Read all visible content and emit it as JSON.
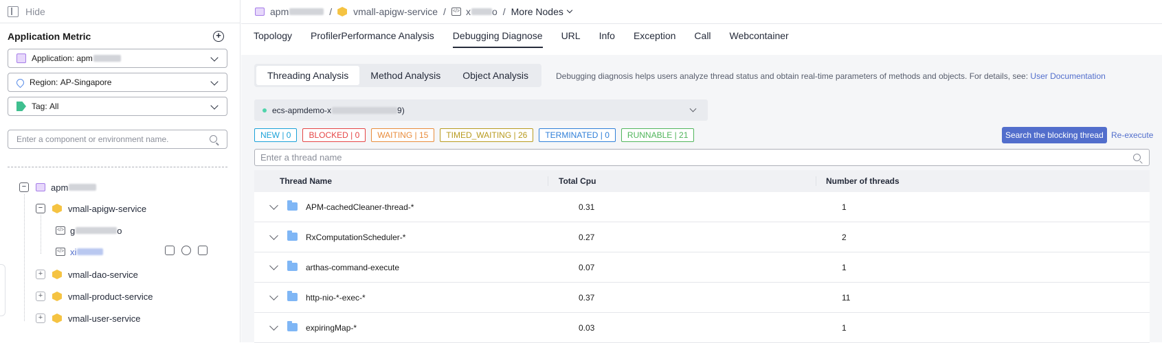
{
  "sidebar": {
    "hide_label": "Hide",
    "title": "Application Metric",
    "application_label": "Application:",
    "application_value": "apm",
    "region_label": "Region:",
    "region_value": "AP-Singapore",
    "tag_label": "Tag:",
    "tag_value": "All",
    "search_placeholder": "Enter a component or environment name.",
    "tree": {
      "root": "apm",
      "service_open": "vmall-apigw-service",
      "env1": "g",
      "env1_tail": "o",
      "env2": "xi",
      "services": [
        "vmall-dao-service",
        "vmall-product-service",
        "vmall-user-service"
      ]
    }
  },
  "breadcrumb": {
    "app": "apm",
    "service": "vmall-apigw-service",
    "env": "x",
    "env_tail": "o",
    "more": "More Nodes",
    "separator": "/"
  },
  "tabs": [
    "Topology",
    "ProfilerPerformance Analysis",
    "Debugging Diagnose",
    "URL",
    "Info",
    "Exception",
    "Call",
    "Webcontainer"
  ],
  "subtabs": [
    "Threading Analysis",
    "Method Analysis",
    "Object Analysis"
  ],
  "description": "Debugging diagnosis helps users analyze thread status and obtain real-time parameters of methods and objects. For details, see:",
  "doc_link": "User Documentation",
  "instance": {
    "prefix": "ecs-apmdemo-x",
    "suffix": "9)"
  },
  "badges": [
    {
      "label": "NEW | 0",
      "color": "#1aa1d8"
    },
    {
      "label": "BLOCKED | 0",
      "color": "#e54545"
    },
    {
      "label": "WAITING | 15",
      "color": "#e88b3a"
    },
    {
      "label": "TIMED_WAITING | 26",
      "color": "#b89a1e"
    },
    {
      "label": "TERMINATED | 0",
      "color": "#2f7fd8"
    },
    {
      "label": "RUNNABLE | 21",
      "color": "#50b55b"
    }
  ],
  "actions": {
    "search_blocking": "Search the blocking thread",
    "reexecute": "Re-execute"
  },
  "thread_search_placeholder": "Enter a thread name",
  "table": {
    "headers": [
      "Thread Name",
      "Total Cpu",
      "Number of threads"
    ],
    "rows": [
      {
        "name": "APM-cachedCleaner-thread-*",
        "cpu": "0.31",
        "count": "1"
      },
      {
        "name": "RxComputationScheduler-*",
        "cpu": "0.27",
        "count": "2"
      },
      {
        "name": "arthas-command-execute",
        "cpu": "0.07",
        "count": "1"
      },
      {
        "name": "http-nio-*-exec-*",
        "cpu": "0.37",
        "count": "11"
      },
      {
        "name": "expiringMap-*",
        "cpu": "0.03",
        "count": "1"
      }
    ]
  }
}
